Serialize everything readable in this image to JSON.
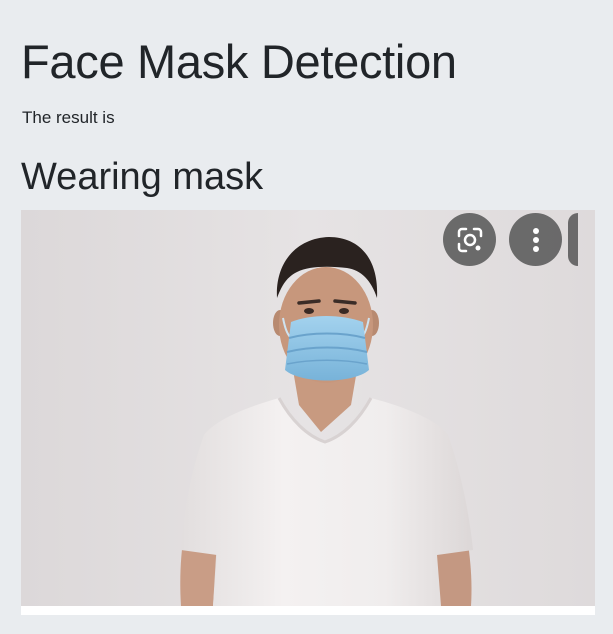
{
  "page": {
    "title": "Face Mask Detection",
    "result_lead": "The result is",
    "result_value": "Wearing mask"
  },
  "image": {
    "subject": "man in white t-shirt wearing a blue surgical face mask",
    "overlay_icons": [
      "lens-search-icon",
      "more-vertical-icon"
    ]
  },
  "colors": {
    "page_background": "#e9ecef",
    "text": "#212529",
    "mask": "#8cc3e4",
    "overlay_button": "#5f5f5f"
  }
}
